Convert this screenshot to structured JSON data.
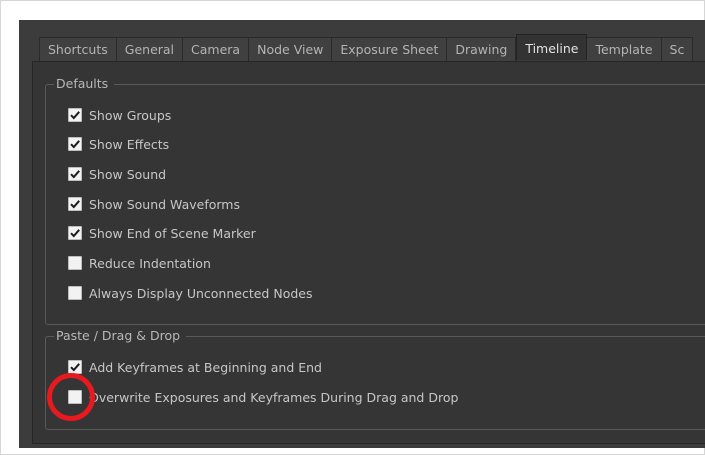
{
  "tabs": [
    {
      "label": "Shortcuts",
      "active": false
    },
    {
      "label": "General",
      "active": false
    },
    {
      "label": "Camera",
      "active": false
    },
    {
      "label": "Node View",
      "active": false
    },
    {
      "label": "Exposure Sheet",
      "active": false
    },
    {
      "label": "Drawing",
      "active": false
    },
    {
      "label": "Timeline",
      "active": true
    },
    {
      "label": "Template",
      "active": false
    },
    {
      "label": "Sc",
      "active": false
    }
  ],
  "defaults": {
    "title": "Defaults",
    "items": [
      {
        "label": "Show Groups",
        "checked": true
      },
      {
        "label": "Show Effects",
        "checked": true
      },
      {
        "label": "Show Sound",
        "checked": true
      },
      {
        "label": "Show Sound Waveforms",
        "checked": true
      },
      {
        "label": "Show End of Scene Marker",
        "checked": true
      },
      {
        "label": "Reduce Indentation",
        "checked": false
      },
      {
        "label": "Always Display Unconnected Nodes",
        "checked": false
      }
    ]
  },
  "paste_drag_drop": {
    "title": "Paste / Drag  & Drop",
    "items": [
      {
        "label": "Add Keyframes at Beginning and End",
        "checked": true
      },
      {
        "label": "Overwrite Exposures and Keyframes During Drag and Drop",
        "checked": false
      }
    ]
  },
  "annotation": {
    "color": "#e8191f",
    "shape": "circle",
    "target": "Overwrite Exposures and Keyframes During Drag and Drop checkbox"
  }
}
